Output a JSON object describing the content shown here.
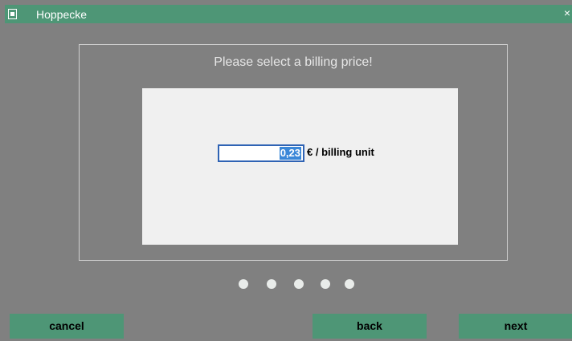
{
  "window": {
    "title": "Hoppecke",
    "app_icon": "app-icon",
    "close_glyph": "×"
  },
  "dialog": {
    "prompt": "Please select a billing price!",
    "price_value": "0,23",
    "unit_label": "€ / billing unit"
  },
  "pager": {
    "dots": [
      "step-1",
      "step-2",
      "step-3",
      "step-4",
      "step-5"
    ]
  },
  "buttons": {
    "cancel": "cancel",
    "back": "back",
    "next": "next"
  },
  "colors": {
    "background": "#808080",
    "accent": "#4e9676",
    "selection": "#3a87d8",
    "input_border": "#2f63b4"
  }
}
